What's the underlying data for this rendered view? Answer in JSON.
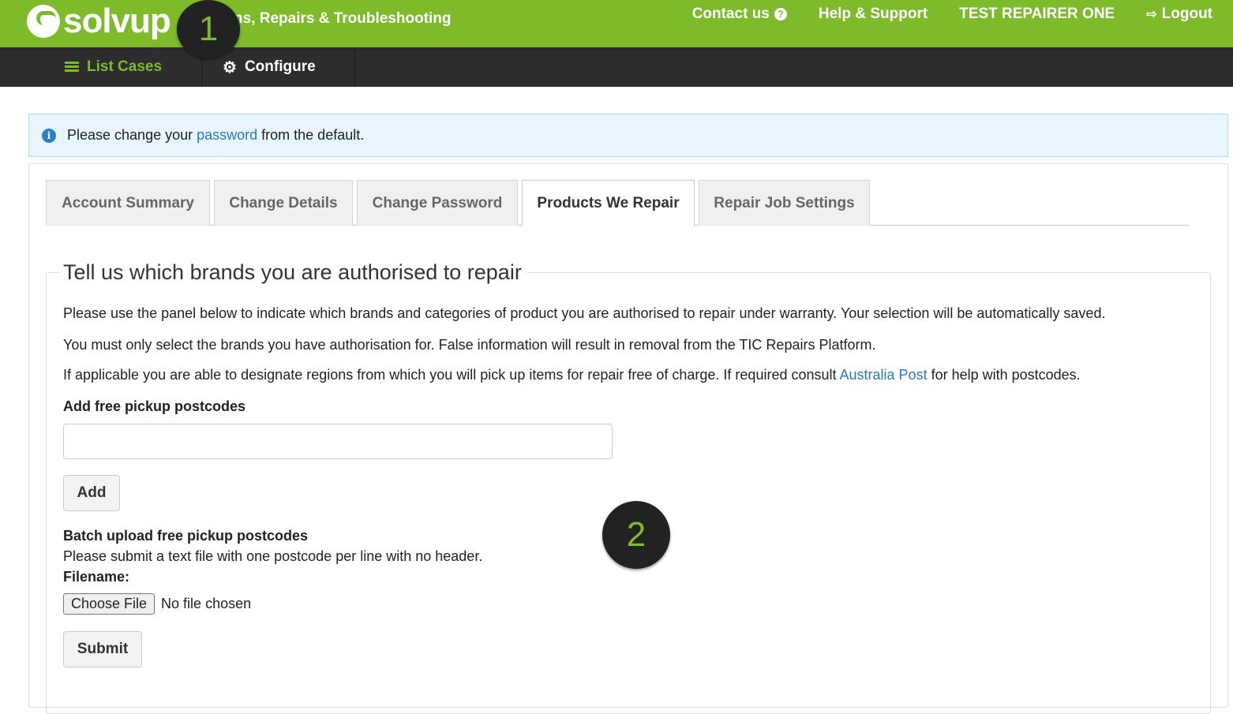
{
  "header": {
    "logo_text": "solvup",
    "app_title": "ns, Repairs & Troubleshooting",
    "nav": {
      "contact": "Contact us",
      "help": "Help & Support",
      "user": "TEST REPAIRER ONE",
      "logout": "Logout"
    }
  },
  "subnav": {
    "list_cases": "List Cases",
    "configure": "Configure"
  },
  "markers": {
    "step1": "1",
    "step2": "2"
  },
  "alert": {
    "prefix": "Please change your ",
    "link": "password",
    "suffix": " from the default."
  },
  "tabs": [
    {
      "label": "Account Summary",
      "active": false
    },
    {
      "label": "Change Details",
      "active": false
    },
    {
      "label": "Change Password",
      "active": false
    },
    {
      "label": "Products We Repair",
      "active": true
    },
    {
      "label": "Repair Job Settings",
      "active": false
    }
  ],
  "section": {
    "legend": "Tell us which brands you are authorised to repair",
    "p1": "Please use the panel below to indicate which brands and categories of product you are authorised to repair under warranty. Your selection will be automatically saved.",
    "p2": "You must only select the brands you have authorisation for. False information will result in removal from the TIC Repairs Platform.",
    "p3_prefix": "If applicable you are able to designate regions from which you will pick up items for repair free of charge. If required consult ",
    "p3_link": "Australia Post",
    "p3_suffix": " for help with postcodes.",
    "add_label": "Add free pickup postcodes",
    "postcode_value": "",
    "add_button": "Add",
    "batch_label": "Batch upload free pickup postcodes",
    "batch_help": "Please submit a text file with one postcode per line with no header.",
    "filename_label": "Filename:",
    "choose_file": "Choose File",
    "no_file": "No file chosen",
    "submit_button": "Submit"
  },
  "colors": {
    "brand_green": "#7dbb2a",
    "dark_nav": "#2d2d2d",
    "link_blue": "#2a78c4",
    "alert_bg": "#e8f5fc"
  }
}
